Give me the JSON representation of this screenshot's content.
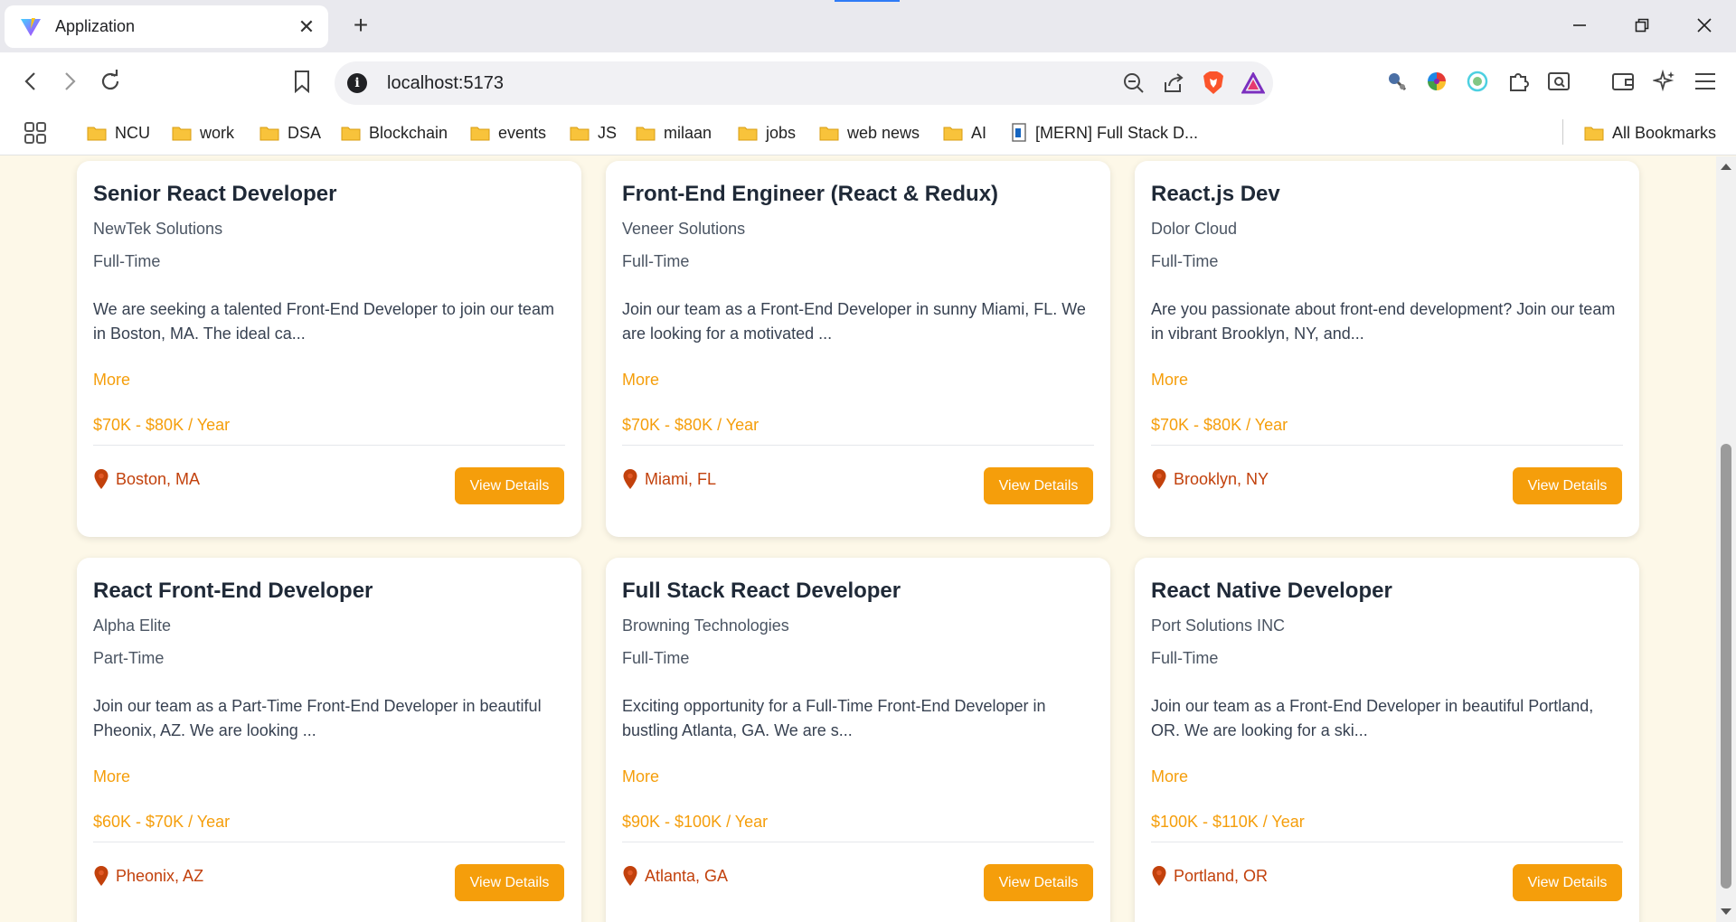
{
  "browser": {
    "tab_title": "Applization",
    "url": "localhost:5173",
    "bookmarks": [
      "NCU",
      "work",
      "DSA",
      "Blockchain",
      "events",
      "JS",
      "milaan",
      "jobs",
      "web news",
      "AI",
      "[MERN] Full Stack D..."
    ],
    "all_bookmarks_label": "All Bookmarks"
  },
  "jobs": [
    {
      "title": "Senior React Developer",
      "company": "NewTek Solutions",
      "type": "Full-Time",
      "description": "We are seeking a talented Front-End Developer to join our team in Boston, MA. The ideal ca...",
      "more": "More",
      "salary": "$70K - $80K / Year",
      "location": "Boston, MA",
      "button": "View Details"
    },
    {
      "title": "Front-End Engineer (React & Redux)",
      "company": "Veneer Solutions",
      "type": "Full-Time",
      "description": "Join our team as a Front-End Developer in sunny Miami, FL. We are looking for a motivated ...",
      "more": "More",
      "salary": "$70K - $80K / Year",
      "location": "Miami, FL",
      "button": "View Details"
    },
    {
      "title": "React.js Dev",
      "company": "Dolor Cloud",
      "type": "Full-Time",
      "description": "Are you passionate about front-end development? Join our team in vibrant Brooklyn, NY, and...",
      "more": "More",
      "salary": "$70K - $80K / Year",
      "location": "Brooklyn, NY",
      "button": "View Details"
    },
    {
      "title": "React Front-End Developer",
      "company": "Alpha Elite",
      "type": "Part-Time",
      "description": "Join our team as a Part-Time Front-End Developer in beautiful Pheonix, AZ. We are looking ...",
      "more": "More",
      "salary": "$60K - $70K / Year",
      "location": "Pheonix, AZ",
      "button": "View Details"
    },
    {
      "title": "Full Stack React Developer",
      "company": "Browning Technologies",
      "type": "Full-Time",
      "description": "Exciting opportunity for a Full-Time Front-End Developer in bustling Atlanta, GA. We are s...",
      "more": "More",
      "salary": "$90K - $100K / Year",
      "location": "Atlanta, GA",
      "button": "View Details"
    },
    {
      "title": "React Native Developer",
      "company": "Port Solutions INC",
      "type": "Full-Time",
      "description": "Join our team as a Front-End Developer in beautiful Portland, OR. We are looking for a ski...",
      "more": "More",
      "salary": "$100K - $110K / Year",
      "location": "Portland, OR",
      "button": "View Details"
    }
  ],
  "colors": {
    "accent": "#f59e0b",
    "location": "#c2410c",
    "page_background": "#fdf8e8"
  }
}
